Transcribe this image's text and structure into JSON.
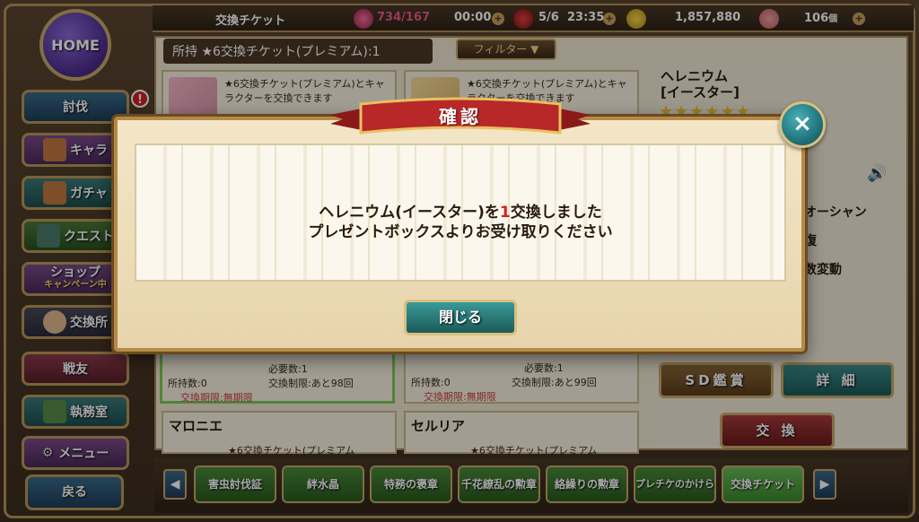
{
  "topbar": {
    "screen_title": "交換チケット",
    "stamina": "734/167",
    "stamina_timer": "00:00",
    "gems": "5/6",
    "gem_timer": "23:35",
    "gold": "1,857,880",
    "medals": "106",
    "medal_suffix": "個"
  },
  "sidebar": {
    "home": "HOME",
    "items": [
      {
        "label": "討伐"
      },
      {
        "label": "キャラ"
      },
      {
        "label": "ガチャ"
      },
      {
        "label": "クエスト"
      },
      {
        "label": "ショップ",
        "sub": "キャンペーン中"
      },
      {
        "label": "交換所"
      },
      {
        "label": "戦友"
      },
      {
        "label": "執務室"
      },
      {
        "label": "メニュー"
      }
    ],
    "alert": "!",
    "back": "戻る"
  },
  "main": {
    "owned": "所持 ★6交換チケット(プレミアム):1",
    "filter": "フィルター",
    "cards": [
      {
        "desc": "★6交換チケット(プレミアム)とキャラクターを交換できます"
      },
      {
        "desc": "★6交換チケット(プレミアム)とキャラクターを交換できます"
      },
      {
        "owned": "所持数:0",
        "required": "必要数:1",
        "limit": "交換制限:あと98回",
        "period": "交換期限:無期限"
      },
      {
        "owned": "所持数:0",
        "required": "必要数:1",
        "limit": "交換制限:あと99回",
        "period": "交換期限:無期限"
      },
      {
        "name": "マロニエ",
        "desc": "★6交換チケット(プレミアム"
      },
      {
        "name": "セルリア",
        "desc": "★6交換チケット(プレミアム"
      }
    ]
  },
  "char_panel": {
    "name_line1": "ヘレニウム",
    "name_line2": "[イースター]",
    "stars": "★★★★★★",
    "stat1": "オーシャン",
    "stat2": "復",
    "stat3": "数変動",
    "sd_button": "SD鑑賞",
    "detail_button": "詳 細",
    "exchange_button": "交 換"
  },
  "tabs": [
    {
      "label": "害虫討伐証"
    },
    {
      "label": "絆水晶"
    },
    {
      "label": "特務の褒章"
    },
    {
      "label": "千花繚乱の勲章"
    },
    {
      "label": "絡繰りの勲章"
    },
    {
      "label": "プレチケのかけら"
    },
    {
      "label": "交換チケット",
      "active": true
    }
  ],
  "dialog": {
    "title": "確認",
    "line1_pre": "ヘレニウム(イースター)を",
    "line1_num": "1",
    "line1_post": "交換しました",
    "line2": "プレゼントボックスよりお受け取りください",
    "close_button": "閉じる",
    "close_icon": "×"
  },
  "colors": {
    "accent_gold": "#c9a868",
    "teal_button": "#1a6a72",
    "highlight_red": "#d02020"
  }
}
